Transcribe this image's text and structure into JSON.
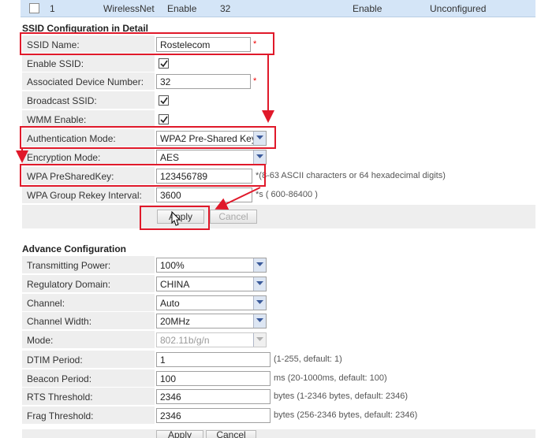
{
  "top_row": {
    "index": "1",
    "ssid": "WirelessNet",
    "status": "Enable",
    "max_devices": "32",
    "broadcast": "Enable",
    "security": "Unconfigured"
  },
  "ssid_config": {
    "title": "SSID Configuration in Detail",
    "ssid_name": {
      "label": "SSID Name:",
      "value": "Rostelecom",
      "required": "*"
    },
    "enable_ssid": {
      "label": "Enable SSID:",
      "checked": true
    },
    "assoc_devices": {
      "label": "Associated Device Number:",
      "value": "32",
      "required": "*"
    },
    "broadcast_ssid": {
      "label": "Broadcast SSID:",
      "checked": true
    },
    "wmm_enable": {
      "label": "WMM Enable:",
      "checked": true
    },
    "auth_mode": {
      "label": "Authentication Mode:",
      "value": "WPA2 Pre-Shared Key"
    },
    "encryption_mode": {
      "label": "Encryption Mode:",
      "value": "AES"
    },
    "wpa_key": {
      "label": "WPA PreSharedKey:",
      "value": "123456789",
      "hint": "*(8-63 ASCII characters or 64 hexadecimal digits)"
    },
    "rekey_interval": {
      "label": "WPA Group Rekey Interval:",
      "value": "3600",
      "hint": "*s ( 600-86400 )"
    },
    "apply_label": "Apply",
    "cancel_label": "Cancel"
  },
  "advance_config": {
    "title": "Advance Configuration",
    "tx_power": {
      "label": "Transmitting Power:",
      "value": "100%"
    },
    "reg_domain": {
      "label": "Regulatory Domain:",
      "value": "CHINA"
    },
    "channel": {
      "label": "Channel:",
      "value": "Auto"
    },
    "channel_width": {
      "label": "Channel Width:",
      "value": "20MHz"
    },
    "mode": {
      "label": "Mode:",
      "value": "802.11b/g/n"
    },
    "dtim": {
      "label": "DTIM Period:",
      "value": "1",
      "hint": "(1-255, default: 1)"
    },
    "beacon": {
      "label": "Beacon Period:",
      "value": "100",
      "hint": "ms (20-1000ms, default: 100)"
    },
    "rts": {
      "label": "RTS Threshold:",
      "value": "2346",
      "hint": "bytes (1-2346 bytes, default: 2346)"
    },
    "frag": {
      "label": "Frag Threshold:",
      "value": "2346",
      "hint": "bytes (256-2346 bytes, default: 2346)"
    },
    "apply_label": "Apply",
    "cancel_label": "Cancel"
  },
  "colors": {
    "annotation_red": "#e0192a",
    "row_bg": "#eeeeee",
    "header_blue": "#d4e5f7"
  }
}
